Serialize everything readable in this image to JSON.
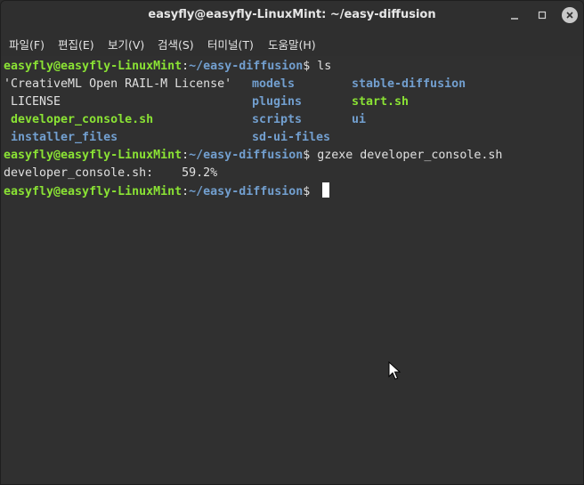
{
  "window": {
    "title": "easyfly@easyfly-LinuxMint: ~/easy-diffusion"
  },
  "menu": {
    "items": [
      "파일(F)",
      "편집(E)",
      "보기(V)",
      "검색(S)",
      "터미널(T)",
      "도움말(H)"
    ]
  },
  "prompt": {
    "user_host": "easyfly@easyfly-LinuxMint",
    "sep": ":",
    "path": "~/easy-diffusion",
    "dollar": "$ "
  },
  "commands": {
    "cmd1": "ls",
    "cmd2": "gzexe developer_console.sh"
  },
  "ls_output": {
    "col1": [
      "'CreativeML Open RAIL-M License'",
      " LICENSE",
      " developer_console.sh",
      " installer_files"
    ],
    "col2": [
      "models",
      "plugins",
      "scripts",
      "sd-ui-files"
    ],
    "col3": [
      "stable-diffusion",
      "start.sh",
      "ui",
      ""
    ]
  },
  "gzexe_output": "developer_console.sh:    59.2%",
  "colors": {
    "user_host": "#8ae234",
    "path": "#729fcf",
    "directory": "#729fcf",
    "executable": "#8ae234",
    "background": "#303030"
  },
  "icons": [
    "minimize-icon",
    "maximize-icon",
    "close-icon",
    "mouse-pointer-icon"
  ]
}
